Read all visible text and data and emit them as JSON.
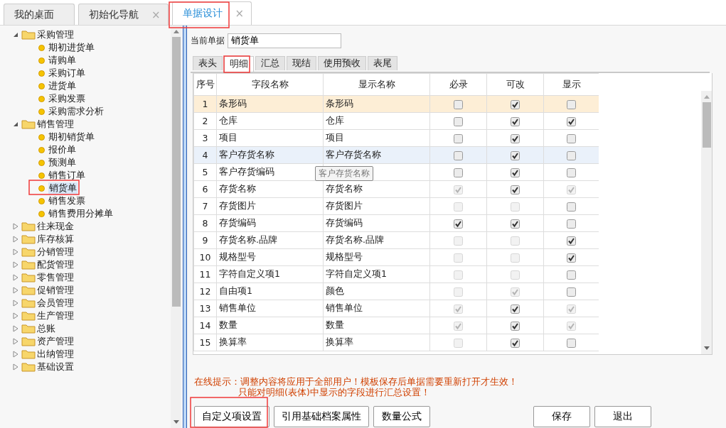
{
  "tabs": [
    {
      "label": "我的桌面",
      "selected": false
    },
    {
      "label": "初始化导航",
      "close": "×",
      "selected": false
    },
    {
      "label": "单据设计",
      "close": "×",
      "selected": true
    }
  ],
  "tree": [
    {
      "label": "采购管理",
      "expanded": true,
      "children": [
        {
          "label": "期初进货单",
          "selected": false
        },
        {
          "label": "请购单",
          "selected": false
        },
        {
          "label": "采购订单",
          "selected": false
        },
        {
          "label": "进货单",
          "selected": false
        },
        {
          "label": "采购发票",
          "selected": false
        },
        {
          "label": "采购需求分析",
          "selected": false
        }
      ]
    },
    {
      "label": "销售管理",
      "expanded": true,
      "children": [
        {
          "label": "期初销货单",
          "selected": false
        },
        {
          "label": "报价单",
          "selected": false
        },
        {
          "label": "预测单",
          "selected": false
        },
        {
          "label": "销售订单",
          "selected": false
        },
        {
          "label": "销货单",
          "selected": true
        },
        {
          "label": "销售发票",
          "selected": false
        },
        {
          "label": "销售费用分摊单",
          "selected": false
        }
      ]
    },
    {
      "label": "往来现金",
      "expanded": false
    },
    {
      "label": "库存核算",
      "expanded": false
    },
    {
      "label": "分销管理",
      "expanded": false
    },
    {
      "label": "配货管理",
      "expanded": false
    },
    {
      "label": "零售管理",
      "expanded": false
    },
    {
      "label": "促销管理",
      "expanded": false
    },
    {
      "label": "会员管理",
      "expanded": false
    },
    {
      "label": "生产管理",
      "expanded": false
    },
    {
      "label": "总账",
      "expanded": false
    },
    {
      "label": "资产管理",
      "expanded": false
    },
    {
      "label": "出纳管理",
      "expanded": false
    },
    {
      "label": "基础设置",
      "expanded": false
    }
  ],
  "current_doc": {
    "label": "当前单据",
    "value": "销货单"
  },
  "sub_tabs": [
    {
      "label": "表头",
      "selected": false
    },
    {
      "label": "明细",
      "selected": true
    },
    {
      "label": "汇总",
      "selected": false
    },
    {
      "label": "现结",
      "selected": false
    },
    {
      "label": "使用预收",
      "selected": false
    },
    {
      "label": "表尾",
      "selected": false
    }
  ],
  "table": {
    "columns": [
      "序号",
      "字段名称",
      "显示名称",
      "必录",
      "可改",
      "显示"
    ],
    "rows": [
      {
        "no": "1",
        "field": "条形码",
        "display": "条形码",
        "highlighted": true,
        "hovered": false,
        "required": {
          "checked": false,
          "disabled": false
        },
        "editable": {
          "checked": true,
          "disabled": false
        },
        "visible": {
          "checked": false,
          "disabled": false
        }
      },
      {
        "no": "2",
        "field": "仓库",
        "display": "仓库",
        "highlighted": false,
        "hovered": false,
        "required": {
          "checked": false,
          "disabled": false
        },
        "editable": {
          "checked": true,
          "disabled": false
        },
        "visible": {
          "checked": true,
          "disabled": false
        }
      },
      {
        "no": "3",
        "field": "项目",
        "display": "项目",
        "highlighted": false,
        "hovered": false,
        "required": {
          "checked": false,
          "disabled": false
        },
        "editable": {
          "checked": true,
          "disabled": false
        },
        "visible": {
          "checked": false,
          "disabled": false
        }
      },
      {
        "no": "4",
        "field": "客户存货名称",
        "display": "客户存货名称",
        "highlighted": false,
        "hovered": true,
        "required": {
          "checked": false,
          "disabled": false
        },
        "editable": {
          "checked": true,
          "disabled": false
        },
        "visible": {
          "checked": false,
          "disabled": false
        }
      },
      {
        "no": "5",
        "field": "客户存货编码",
        "tooltip": "客户存货名称",
        "highlighted": false,
        "hovered": false,
        "required": {
          "checked": false,
          "disabled": false
        },
        "editable": {
          "checked": true,
          "disabled": false
        },
        "visible": {
          "checked": false,
          "disabled": false
        }
      },
      {
        "no": "6",
        "field": "存货名称",
        "display": "存货名称",
        "highlighted": false,
        "hovered": false,
        "required": {
          "checked": true,
          "disabled": true
        },
        "editable": {
          "checked": true,
          "disabled": false
        },
        "visible": {
          "checked": true,
          "disabled": true
        }
      },
      {
        "no": "7",
        "field": "存货图片",
        "display": "存货图片",
        "highlighted": false,
        "hovered": false,
        "required": {
          "checked": false,
          "disabled": true
        },
        "editable": {
          "checked": false,
          "disabled": true
        },
        "visible": {
          "checked": false,
          "disabled": false
        }
      },
      {
        "no": "8",
        "field": "存货编码",
        "display": "存货编码",
        "highlighted": false,
        "hovered": false,
        "required": {
          "checked": true,
          "disabled": false
        },
        "editable": {
          "checked": true,
          "disabled": false
        },
        "visible": {
          "checked": false,
          "disabled": false
        }
      },
      {
        "no": "9",
        "field": "存货名称.品牌",
        "display": "存货名称.品牌",
        "highlighted": false,
        "hovered": false,
        "required": {
          "checked": false,
          "disabled": true
        },
        "editable": {
          "checked": false,
          "disabled": true
        },
        "visible": {
          "checked": true,
          "disabled": false
        }
      },
      {
        "no": "10",
        "field": "规格型号",
        "display": "规格型号",
        "highlighted": false,
        "hovered": false,
        "required": {
          "checked": false,
          "disabled": true
        },
        "editable": {
          "checked": false,
          "disabled": true
        },
        "visible": {
          "checked": true,
          "disabled": false
        }
      },
      {
        "no": "11",
        "field": "字符自定义项1",
        "display": "字符自定义项1",
        "highlighted": false,
        "hovered": false,
        "required": {
          "checked": false,
          "disabled": true
        },
        "editable": {
          "checked": false,
          "disabled": true
        },
        "visible": {
          "checked": false,
          "disabled": false
        }
      },
      {
        "no": "12",
        "field": "自由项1",
        "display": "颜色",
        "highlighted": false,
        "hovered": false,
        "required": {
          "checked": false,
          "disabled": true
        },
        "editable": {
          "checked": true,
          "disabled": true
        },
        "visible": {
          "checked": false,
          "disabled": false
        }
      },
      {
        "no": "13",
        "field": "销售单位",
        "display": "销售单位",
        "highlighted": false,
        "hovered": false,
        "required": {
          "checked": true,
          "disabled": true
        },
        "editable": {
          "checked": true,
          "disabled": false
        },
        "visible": {
          "checked": true,
          "disabled": true
        }
      },
      {
        "no": "14",
        "field": "数量",
        "display": "数量",
        "highlighted": false,
        "hovered": false,
        "required": {
          "checked": true,
          "disabled": true
        },
        "editable": {
          "checked": true,
          "disabled": false
        },
        "visible": {
          "checked": true,
          "disabled": true
        }
      },
      {
        "no": "15",
        "field": "换算率",
        "display": "换算率",
        "highlighted": false,
        "hovered": false,
        "required": {
          "checked": false,
          "disabled": true
        },
        "editable": {
          "checked": true,
          "disabled": false
        },
        "visible": {
          "checked": false,
          "disabled": false
        }
      }
    ]
  },
  "notice": [
    "在线提示：调整内容将应用于全部用户！模板保存后单据需要重新打开才生效！",
    "只能对明细(表体)中显示的字段进行汇总设置！"
  ],
  "buttons_left": [
    "自定义项设置",
    "引用基础档案属性",
    "数量公式"
  ],
  "buttons_right": [
    "保存",
    "退出"
  ]
}
